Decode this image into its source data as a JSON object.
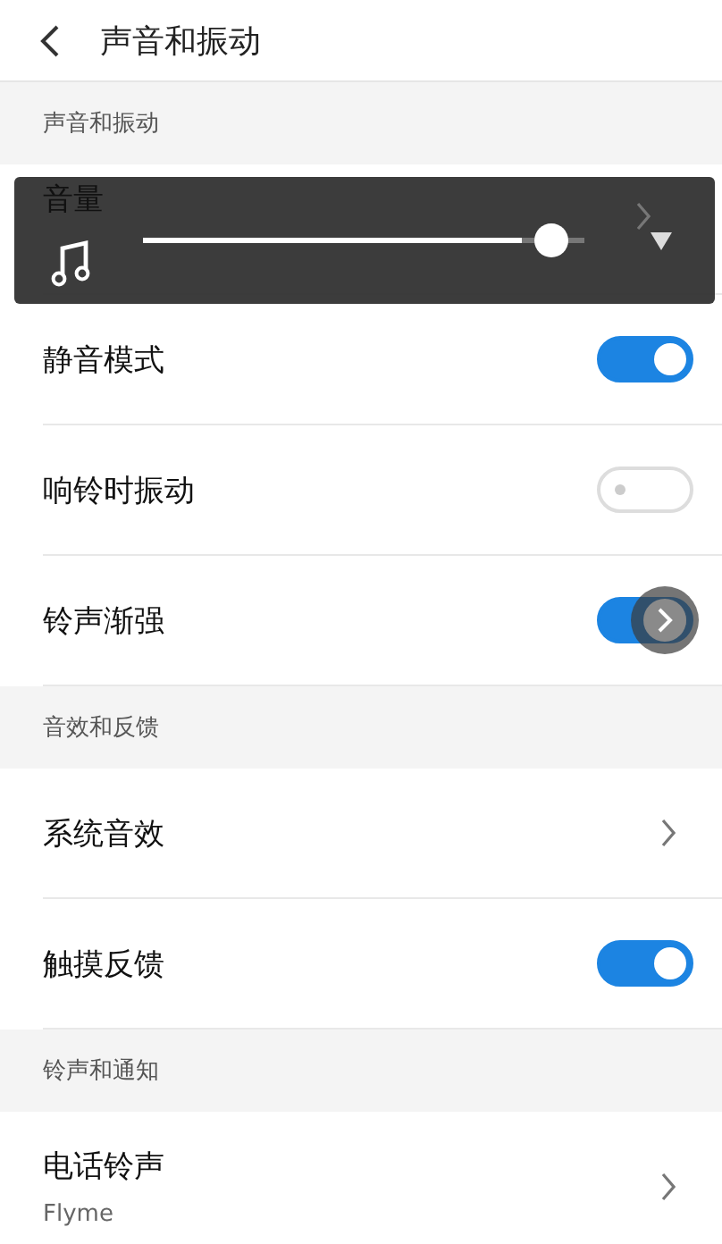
{
  "header": {
    "title": "声音和振动"
  },
  "sections": [
    {
      "title": "声音和振动",
      "rows": [
        {
          "kind": "link",
          "label": "音量"
        },
        {
          "kind": "toggle",
          "label": "静音模式",
          "on": true
        },
        {
          "kind": "toggle",
          "label": "响铃时振动",
          "on": false
        },
        {
          "kind": "toggle",
          "label": "铃声渐强",
          "on": true
        }
      ]
    },
    {
      "title": "音效和反馈",
      "rows": [
        {
          "kind": "link",
          "label": "系统音效"
        },
        {
          "kind": "toggle",
          "label": "触摸反馈",
          "on": true
        }
      ]
    },
    {
      "title": "铃声和通知",
      "rows": [
        {
          "kind": "link",
          "label": "电话铃声",
          "subtitle": "Flyme"
        }
      ]
    }
  ],
  "volume_panel": {
    "level": 0.86
  }
}
